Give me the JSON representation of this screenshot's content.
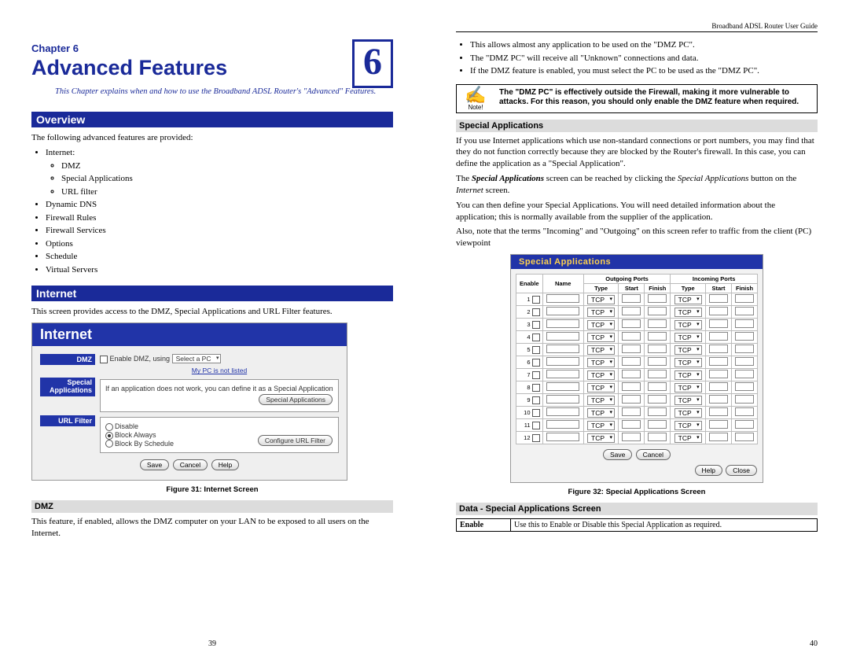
{
  "header_right": "Broadband ADSL Router User Guide",
  "chapter": {
    "label": "Chapter 6",
    "title": "Advanced Features",
    "number": "6",
    "intro": "This Chapter explains when and how to use the Broadband ADSL Router's \"Advanced\" Features."
  },
  "overview": {
    "heading": "Overview",
    "lead": "The following advanced features are provided:",
    "items": [
      "Internet:",
      "Dynamic DNS",
      "Firewall Rules",
      "Firewall Services",
      "Options",
      "Schedule",
      "Virtual Servers"
    ],
    "internet_sub": [
      "DMZ",
      "Special Applications",
      "URL filter"
    ]
  },
  "internet": {
    "heading": "Internet",
    "lead": "This screen provides access to the DMZ, Special Applications and URL Filter features.",
    "fig_caption": "Figure 31: Internet Screen"
  },
  "fig31": {
    "title": "Internet",
    "rows": {
      "dmz_label": "DMZ",
      "dmz_chk": "Enable DMZ, using",
      "dmz_sel": "Select a PC",
      "dmz_link": "My PC is not listed",
      "spec_label": "Special Applications",
      "spec_text": "If an application does not work, you can define it as a Special Application",
      "spec_btn": "Special Applications",
      "url_label": "URL Filter",
      "url_r1": "Disable",
      "url_r2": "Block Always",
      "url_r3": "Block By Schedule",
      "url_btn": "Configure URL Filter",
      "btn_save": "Save",
      "btn_cancel": "Cancel",
      "btn_help": "Help"
    }
  },
  "dmz": {
    "heading": "DMZ",
    "para": "This feature, if enabled, allows the DMZ computer on your LAN to be exposed to all users on the Internet."
  },
  "page_left_num": "39",
  "right_bullets": [
    "This allows almost any application to be used on the \"DMZ PC\".",
    "The \"DMZ PC\" will receive all \"Unknown\" connections and data.",
    "If the DMZ feature is enabled, you must select the PC to be used as the \"DMZ PC\"."
  ],
  "note": {
    "label": "Note!",
    "text": "The \"DMZ PC\" is effectively outside the Firewall, making it more vulnerable to attacks. For this reason, you should only enable the DMZ feature when required."
  },
  "spec_app": {
    "heading": "Special Applications",
    "p1": "If you use Internet applications which use non-standard connections or port numbers, you may find that they do not function correctly because they are blocked by the Router's firewall. In this case, you can define the application as a \"Special Application\".",
    "p2_a": "The ",
    "p2_b": "Special Applications",
    "p2_c": " screen can be reached by clicking the ",
    "p2_d": "Special Applications",
    "p2_e": " button on the ",
    "p2_f": "Internet",
    "p2_g": " screen.",
    "p3": "You can then define your Special Applications. You will need detailed information about the application; this is normally available from the supplier of the application.",
    "p4": "Also, note that the terms \"Incoming\" and \"Outgoing\" on this screen refer to traffic from the client (PC) viewpoint",
    "fig_caption": "Figure 32: Special Applications Screen"
  },
  "fig32": {
    "title": "Special Applications",
    "headers": {
      "enable": "Enable",
      "name": "Name",
      "out": "Outgoing Ports",
      "in": "Incoming Ports",
      "type": "Type",
      "start": "Start",
      "finish": "Finish"
    },
    "rows": [
      "1",
      "2",
      "3",
      "4",
      "5",
      "6",
      "7",
      "8",
      "9",
      "10",
      "11",
      "12"
    ],
    "tcp": "TCP",
    "btn_save": "Save",
    "btn_cancel": "Cancel",
    "btn_help": "Help",
    "btn_close": "Close"
  },
  "data_section": {
    "heading": "Data - Special Applications Screen",
    "row1_label": "Enable",
    "row1_text": "Use this to Enable or Disable this Special Application as required."
  },
  "page_right_num": "40"
}
